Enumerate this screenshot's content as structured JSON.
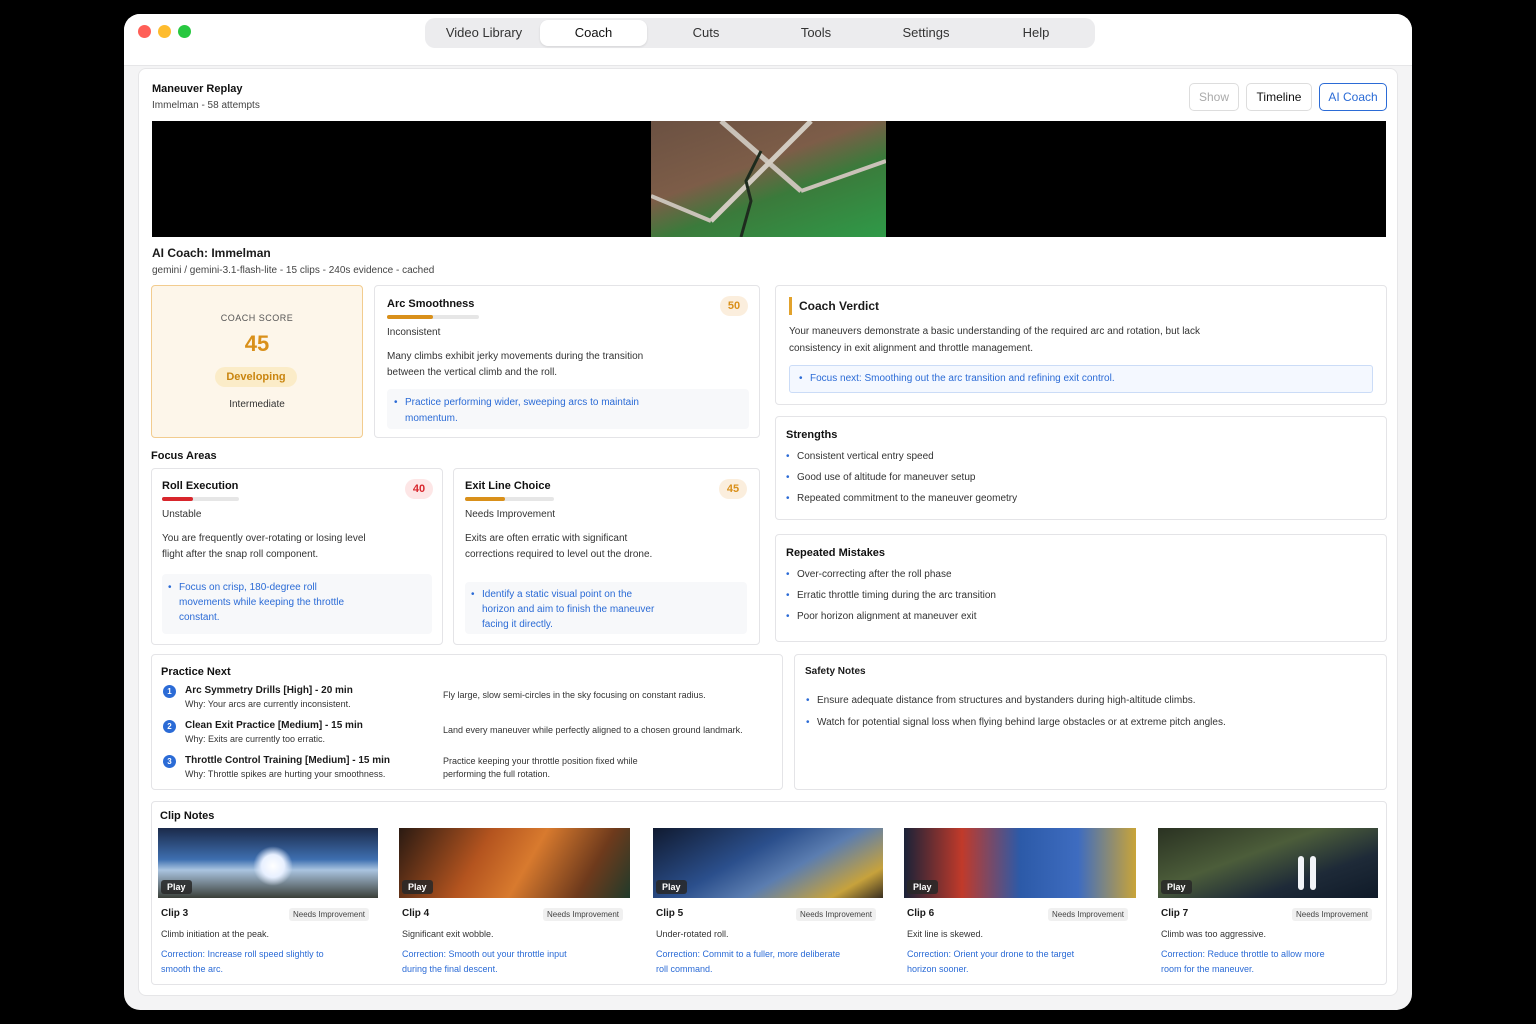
{
  "nav": {
    "tabs": [
      "Video Library",
      "Coach",
      "Cuts",
      "Tools",
      "Settings",
      "Help"
    ],
    "active": "Coach"
  },
  "replay": {
    "title": "Maneuver Replay",
    "subtitle": "Immelman - 58 attempts",
    "buttons": {
      "show": "Show",
      "timeline": "Timeline",
      "ai_coach": "AI Coach"
    }
  },
  "coach": {
    "title": "AI Coach: Immelman",
    "meta": "gemini / gemini-3.1-flash-lite - 15 clips - 240s evidence - cached"
  },
  "score": {
    "label": "COACH SCORE",
    "value": "45",
    "badge": "Developing",
    "level": "Intermediate"
  },
  "arc": {
    "title": "Arc Smoothness",
    "score": "50",
    "score_fraction": 0.5,
    "status": "Inconsistent",
    "desc": "Many climbs exhibit jerky movements during the transition between the vertical climb and the roll.",
    "tip": "Practice performing wider, sweeping arcs to maintain momentum."
  },
  "verdict": {
    "title": "Coach Verdict",
    "text": "Your maneuvers demonstrate a basic understanding of the required arc and rotation, but lack consistency in exit alignment and throttle management.",
    "focus": "Focus next: Smoothing out the arc transition and refining exit control."
  },
  "focus_areas": {
    "title": "Focus Areas",
    "roll": {
      "title": "Roll Execution",
      "score": "40",
      "score_fraction": 0.4,
      "status": "Unstable",
      "desc": "You are frequently over-rotating or losing level flight after the snap roll component.",
      "tip": "Focus on crisp, 180-degree roll movements while keeping the throttle constant."
    },
    "exit": {
      "title": "Exit Line Choice",
      "score": "45",
      "score_fraction": 0.45,
      "status": "Needs Improvement",
      "desc": "Exits are often erratic with significant corrections required to level out the drone.",
      "tip": "Identify a static visual point on the horizon and aim to finish the maneuver facing it directly."
    }
  },
  "strengths": {
    "title": "Strengths",
    "items": [
      "Consistent vertical entry speed",
      "Good use of altitude for maneuver setup",
      "Repeated commitment to the maneuver geometry"
    ]
  },
  "mistakes": {
    "title": "Repeated Mistakes",
    "items": [
      "Over-correcting after the roll phase",
      "Erratic throttle timing during the arc transition",
      "Poor horizon alignment at maneuver exit"
    ]
  },
  "practice": {
    "title": "Practice Next",
    "items": [
      {
        "num": "1",
        "name": "Arc Symmetry Drills [High] - 20 min",
        "why": "Why: Your arcs are currently inconsistent.",
        "desc": "Fly large, slow semi-circles in the sky focusing on constant radius."
      },
      {
        "num": "2",
        "name": "Clean Exit Practice [Medium] - 15 min",
        "why": "Why: Exits are currently too erratic.",
        "desc": "Land every maneuver while perfectly aligned to a chosen ground landmark."
      },
      {
        "num": "3",
        "name": "Throttle Control Training [Medium] - 15 min",
        "why": "Why: Throttle spikes are hurting your smoothness.",
        "desc": "Practice keeping your throttle position fixed while performing the full rotation."
      }
    ]
  },
  "safety": {
    "title": "Safety Notes",
    "items": [
      "Ensure adequate distance from structures and bystanders during high-altitude climbs.",
      "Watch for potential signal loss when flying behind large obstacles or at extreme pitch angles."
    ]
  },
  "clips": {
    "title": "Clip Notes",
    "play_label": "Play",
    "items": [
      {
        "name": "Clip 3",
        "badge": "Needs Improvement",
        "note": "Climb initiation at the peak.",
        "correction": "Correction: Increase roll speed slightly to smooth the arc."
      },
      {
        "name": "Clip 4",
        "badge": "Needs Improvement",
        "note": "Significant exit wobble.",
        "correction": "Correction: Smooth out your throttle input during the final descent."
      },
      {
        "name": "Clip 5",
        "badge": "Needs Improvement",
        "note": "Under-rotated roll.",
        "correction": "Correction: Commit to a fuller, more deliberate roll command."
      },
      {
        "name": "Clip 6",
        "badge": "Needs Improvement",
        "note": "Exit line is skewed.",
        "correction": "Correction: Orient your drone to the target horizon sooner."
      },
      {
        "name": "Clip 7",
        "badge": "Needs Improvement",
        "note": "Climb was too aggressive.",
        "correction": "Correction: Reduce throttle to allow more room for the maneuver."
      }
    ]
  },
  "colors": {
    "accent": "#2b6bd6",
    "score_orange": "#d9901a",
    "danger_red": "#d8262c"
  }
}
